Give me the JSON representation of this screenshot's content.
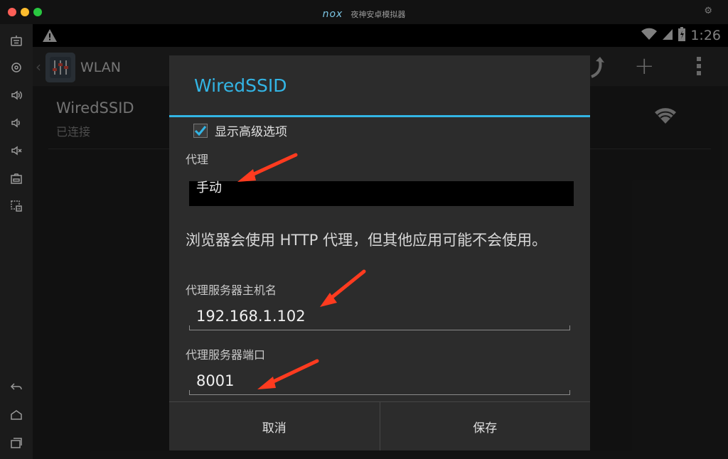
{
  "window": {
    "logo": "nox",
    "title": "夜神安卓模拟器"
  },
  "colors": {
    "accent": "#33b5e5",
    "annotation_arrow": "#ff3b1f"
  },
  "sidebar": {
    "icons": [
      "keyboard-icon",
      "location-icon",
      "volume-up-icon",
      "volume-down-icon",
      "mute-icon",
      "screenshot-icon",
      "multi-instance-icon",
      "back-icon",
      "home-icon",
      "recent-apps-icon"
    ]
  },
  "statusbar": {
    "time": "1:26"
  },
  "actionbar": {
    "title": "WLAN"
  },
  "network_list": {
    "items": [
      {
        "ssid": "WiredSSID",
        "status": "已连接"
      }
    ]
  },
  "dialog": {
    "title": "WiredSSID",
    "advanced_checkbox": {
      "label": "显示高级选项",
      "checked": true
    },
    "proxy": {
      "label": "代理",
      "value": "手动"
    },
    "hint": "浏览器会使用 HTTP 代理，但其他应用可能不会使用。",
    "hostname": {
      "label": "代理服务器主机名",
      "value": "192.168.1.102"
    },
    "port": {
      "label": "代理服务器端口",
      "value": "8001"
    },
    "buttons": {
      "cancel": "取消",
      "save": "保存"
    }
  }
}
